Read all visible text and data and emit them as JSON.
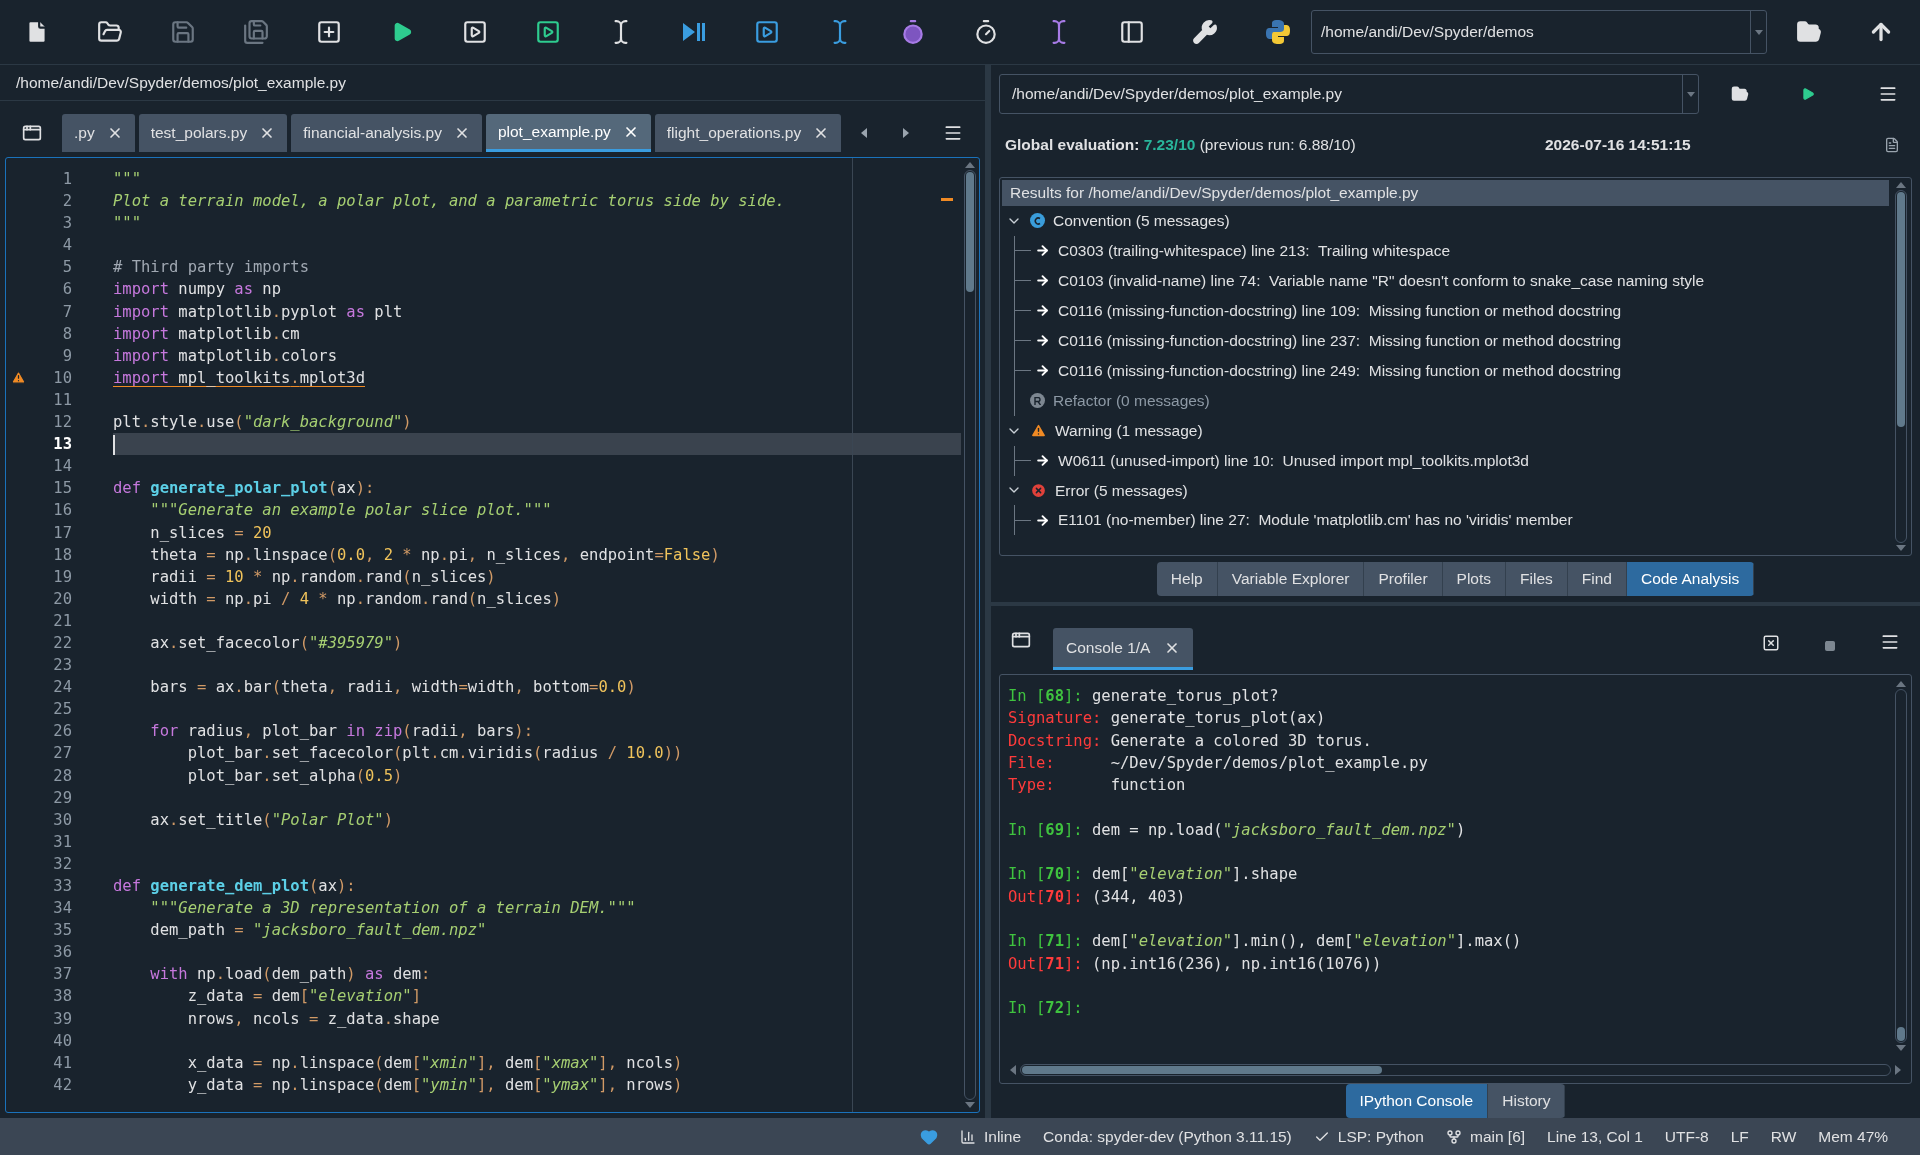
{
  "toolbar": {
    "path": "/home/andi/Dev/Spyder/demos"
  },
  "editor": {
    "file_path": "/home/andi/Dev/Spyder/demos/plot_example.py",
    "tabs": [
      {
        "label": ".py",
        "selected": false
      },
      {
        "label": "test_polars.py",
        "selected": false
      },
      {
        "label": "financial-analysis.py",
        "selected": false
      },
      {
        "label": "plot_example.py",
        "selected": true
      },
      {
        "label": "flight_operations.py",
        "selected": false
      }
    ],
    "lines": [
      {
        "number": "1",
        "current": false,
        "warning": false,
        "tokens": [
          {
            "kind": "str",
            "text": "\"\"\""
          }
        ]
      },
      {
        "number": "2",
        "current": false,
        "warning": false,
        "tokens": [
          {
            "kind": "str",
            "text": "Plot a terrain model, a polar plot, and a parametric torus side by side."
          }
        ]
      },
      {
        "number": "3",
        "current": false,
        "warning": false,
        "tokens": [
          {
            "kind": "str",
            "text": "\"\"\""
          }
        ]
      },
      {
        "number": "4",
        "current": false,
        "warning": false
      },
      {
        "number": "5",
        "current": false,
        "warning": false,
        "tokens": [
          {
            "kind": "com",
            "text": "# Third party imports"
          }
        ]
      },
      {
        "number": "6",
        "current": false,
        "warning": false,
        "tokens": [
          {
            "kind": "kw",
            "text": "import"
          },
          {
            "kind": "txt",
            "text": " numpy "
          },
          {
            "kind": "kw",
            "text": "as"
          },
          {
            "kind": "txt",
            "text": " np"
          }
        ]
      },
      {
        "number": "7",
        "current": false,
        "warning": false,
        "tokens": [
          {
            "kind": "kw",
            "text": "import"
          },
          {
            "kind": "txt",
            "text": " matplotlib"
          },
          {
            "kind": "op",
            "text": "."
          },
          {
            "kind": "txt",
            "text": "pyplot "
          },
          {
            "kind": "kw",
            "text": "as"
          },
          {
            "kind": "txt",
            "text": " plt"
          }
        ]
      },
      {
        "number": "8",
        "current": false,
        "warning": false,
        "tokens": [
          {
            "kind": "kw",
            "text": "import"
          },
          {
            "kind": "txt",
            "text": " matplotlib"
          },
          {
            "kind": "op",
            "text": "."
          },
          {
            "kind": "txt",
            "text": "cm"
          }
        ]
      },
      {
        "number": "9",
        "current": false,
        "warning": false,
        "tokens": [
          {
            "kind": "kw",
            "text": "import"
          },
          {
            "kind": "txt",
            "text": " matplotlib"
          },
          {
            "kind": "op",
            "text": "."
          },
          {
            "kind": "txt",
            "text": "colors"
          }
        ]
      },
      {
        "number": "10",
        "current": false,
        "warning": true,
        "tokens": [
          {
            "kind": "kw",
            "text": "import"
          },
          {
            "kind": "txt",
            "text": " mpl_toolkits"
          },
          {
            "kind": "op",
            "text": "."
          },
          {
            "kind": "txt",
            "text": "mplot3d"
          }
        ]
      },
      {
        "number": "11",
        "current": false,
        "warning": false
      },
      {
        "number": "12",
        "current": false,
        "warning": false,
        "tokens": [
          {
            "kind": "txt",
            "text": "plt"
          },
          {
            "kind": "op",
            "text": "."
          },
          {
            "kind": "txt",
            "text": "style"
          },
          {
            "kind": "op",
            "text": "."
          },
          {
            "kind": "txt",
            "text": "use"
          },
          {
            "kind": "op",
            "text": "("
          },
          {
            "kind": "str",
            "text": "\"dark_background\""
          },
          {
            "kind": "op",
            "text": ")"
          }
        ]
      },
      {
        "number": "13",
        "current": true,
        "warning": false
      },
      {
        "number": "14",
        "current": false,
        "warning": false
      },
      {
        "number": "15",
        "current": false,
        "warning": false,
        "tokens": [
          {
            "kind": "kw",
            "text": "def "
          },
          {
            "kind": "def",
            "text": "generate_polar_plot"
          },
          {
            "kind": "op",
            "text": "("
          },
          {
            "kind": "txt",
            "text": "ax"
          },
          {
            "kind": "op",
            "text": "):"
          }
        ]
      },
      {
        "number": "16",
        "current": false,
        "warning": false,
        "tokens": [
          {
            "kind": "str",
            "text": "    \"\"\"Generate an example polar slice plot.\"\"\""
          }
        ]
      },
      {
        "number": "17",
        "current": false,
        "warning": false,
        "tokens": [
          {
            "kind": "txt",
            "text": "    n_slices "
          },
          {
            "kind": "op",
            "text": "= "
          },
          {
            "kind": "num",
            "text": "20"
          }
        ]
      },
      {
        "number": "18",
        "current": false,
        "warning": false,
        "tokens": [
          {
            "kind": "txt",
            "text": "    theta "
          },
          {
            "kind": "op",
            "text": "="
          },
          {
            "kind": "txt",
            "text": " np"
          },
          {
            "kind": "op",
            "text": "."
          },
          {
            "kind": "txt",
            "text": "linspace"
          },
          {
            "kind": "op",
            "text": "("
          },
          {
            "kind": "num",
            "text": "0.0"
          },
          {
            "kind": "op",
            "text": ", "
          },
          {
            "kind": "num",
            "text": "2"
          },
          {
            "kind": "op",
            "text": " *"
          },
          {
            "kind": "txt",
            "text": " np"
          },
          {
            "kind": "op",
            "text": "."
          },
          {
            "kind": "txt",
            "text": "pi"
          },
          {
            "kind": "op",
            "text": ", "
          },
          {
            "kind": "txt",
            "text": "n_slices"
          },
          {
            "kind": "op",
            "text": ", "
          },
          {
            "kind": "txt",
            "text": "endpoint"
          },
          {
            "kind": "op",
            "text": "="
          },
          {
            "kind": "num",
            "text": "False"
          },
          {
            "kind": "op",
            "text": ")"
          }
        ]
      },
      {
        "number": "19",
        "current": false,
        "warning": false,
        "tokens": [
          {
            "kind": "txt",
            "text": "    radii "
          },
          {
            "kind": "op",
            "text": "= "
          },
          {
            "kind": "num",
            "text": "10"
          },
          {
            "kind": "op",
            "text": " *"
          },
          {
            "kind": "txt",
            "text": " np"
          },
          {
            "kind": "op",
            "text": "."
          },
          {
            "kind": "txt",
            "text": "random"
          },
          {
            "kind": "op",
            "text": "."
          },
          {
            "kind": "txt",
            "text": "rand"
          },
          {
            "kind": "op",
            "text": "("
          },
          {
            "kind": "txt",
            "text": "n_slices"
          },
          {
            "kind": "op",
            "text": ")"
          }
        ]
      },
      {
        "number": "20",
        "current": false,
        "warning": false,
        "tokens": [
          {
            "kind": "txt",
            "text": "    width "
          },
          {
            "kind": "op",
            "text": "="
          },
          {
            "kind": "txt",
            "text": " np"
          },
          {
            "kind": "op",
            "text": "."
          },
          {
            "kind": "txt",
            "text": "pi "
          },
          {
            "kind": "op",
            "text": "/ "
          },
          {
            "kind": "num",
            "text": "4"
          },
          {
            "kind": "op",
            "text": " *"
          },
          {
            "kind": "txt",
            "text": " np"
          },
          {
            "kind": "op",
            "text": "."
          },
          {
            "kind": "txt",
            "text": "random"
          },
          {
            "kind": "op",
            "text": "."
          },
          {
            "kind": "txt",
            "text": "rand"
          },
          {
            "kind": "op",
            "text": "("
          },
          {
            "kind": "txt",
            "text": "n_slices"
          },
          {
            "kind": "op",
            "text": ")"
          }
        ]
      },
      {
        "number": "21",
        "current": false,
        "warning": false
      },
      {
        "number": "22",
        "current": false,
        "warning": false,
        "tokens": [
          {
            "kind": "txt",
            "text": "    ax"
          },
          {
            "kind": "op",
            "text": "."
          },
          {
            "kind": "txt",
            "text": "set_facecolor"
          },
          {
            "kind": "op",
            "text": "("
          },
          {
            "kind": "str",
            "text": "\"#395979\""
          },
          {
            "kind": "op",
            "text": ")"
          }
        ]
      },
      {
        "number": "23",
        "current": false,
        "warning": false
      },
      {
        "number": "24",
        "current": false,
        "warning": false,
        "tokens": [
          {
            "kind": "txt",
            "text": "    bars "
          },
          {
            "kind": "op",
            "text": "="
          },
          {
            "kind": "txt",
            "text": " ax"
          },
          {
            "kind": "op",
            "text": "."
          },
          {
            "kind": "txt",
            "text": "bar"
          },
          {
            "kind": "op",
            "text": "("
          },
          {
            "kind": "txt",
            "text": "theta"
          },
          {
            "kind": "op",
            "text": ", "
          },
          {
            "kind": "txt",
            "text": "radii"
          },
          {
            "kind": "op",
            "text": ", "
          },
          {
            "kind": "txt",
            "text": "width"
          },
          {
            "kind": "op",
            "text": "="
          },
          {
            "kind": "txt",
            "text": "width"
          },
          {
            "kind": "op",
            "text": ", "
          },
          {
            "kind": "txt",
            "text": "bottom"
          },
          {
            "kind": "op",
            "text": "="
          },
          {
            "kind": "num",
            "text": "0.0"
          },
          {
            "kind": "op",
            "text": ")"
          }
        ]
      },
      {
        "number": "25",
        "current": false,
        "warning": false
      },
      {
        "number": "26",
        "current": false,
        "warning": false,
        "tokens": [
          {
            "kind": "kw",
            "text": "    for"
          },
          {
            "kind": "txt",
            "text": " radius"
          },
          {
            "kind": "op",
            "text": ", "
          },
          {
            "kind": "txt",
            "text": "plot_bar "
          },
          {
            "kind": "kw",
            "text": "in"
          },
          {
            "kind": "kw",
            "text": " zip"
          },
          {
            "kind": "op",
            "text": "("
          },
          {
            "kind": "txt",
            "text": "radii"
          },
          {
            "kind": "op",
            "text": ", "
          },
          {
            "kind": "txt",
            "text": "bars"
          },
          {
            "kind": "op",
            "text": "):"
          }
        ]
      },
      {
        "number": "27",
        "current": false,
        "warning": false,
        "tokens": [
          {
            "kind": "txt",
            "text": "        plot_bar"
          },
          {
            "kind": "op",
            "text": "."
          },
          {
            "kind": "txt",
            "text": "set_facecolor"
          },
          {
            "kind": "op",
            "text": "("
          },
          {
            "kind": "txt",
            "text": "plt"
          },
          {
            "kind": "op",
            "text": "."
          },
          {
            "kind": "txt",
            "text": "cm"
          },
          {
            "kind": "op",
            "text": "."
          },
          {
            "kind": "txt",
            "text": "viridis"
          },
          {
            "kind": "op",
            "text": "("
          },
          {
            "kind": "txt",
            "text": "radius "
          },
          {
            "kind": "op",
            "text": "/ "
          },
          {
            "kind": "num",
            "text": "10.0"
          },
          {
            "kind": "op",
            "text": "))"
          }
        ]
      },
      {
        "number": "28",
        "current": false,
        "warning": false,
        "tokens": [
          {
            "kind": "txt",
            "text": "        plot_bar"
          },
          {
            "kind": "op",
            "text": "."
          },
          {
            "kind": "txt",
            "text": "set_alpha"
          },
          {
            "kind": "op",
            "text": "("
          },
          {
            "kind": "num",
            "text": "0.5"
          },
          {
            "kind": "op",
            "text": ")"
          }
        ]
      },
      {
        "number": "29",
        "current": false,
        "warning": false
      },
      {
        "number": "30",
        "current": false,
        "warning": false,
        "tokens": [
          {
            "kind": "txt",
            "text": "    ax"
          },
          {
            "kind": "op",
            "text": "."
          },
          {
            "kind": "txt",
            "text": "set_title"
          },
          {
            "kind": "op",
            "text": "("
          },
          {
            "kind": "str",
            "text": "\"Polar Plot\""
          },
          {
            "kind": "op",
            "text": ")"
          }
        ]
      },
      {
        "number": "31",
        "current": false,
        "warning": false
      },
      {
        "number": "32",
        "current": false,
        "warning": false
      },
      {
        "number": "33",
        "current": false,
        "warning": false,
        "tokens": [
          {
            "kind": "kw",
            "text": "def "
          },
          {
            "kind": "def",
            "text": "generate_dem_plot"
          },
          {
            "kind": "op",
            "text": "("
          },
          {
            "kind": "txt",
            "text": "ax"
          },
          {
            "kind": "op",
            "text": "):"
          }
        ]
      },
      {
        "number": "34",
        "current": false,
        "warning": false,
        "tokens": [
          {
            "kind": "str",
            "text": "    \"\"\"Generate a 3D representation of a terrain DEM.\"\"\""
          }
        ]
      },
      {
        "number": "35",
        "current": false,
        "warning": false,
        "tokens": [
          {
            "kind": "txt",
            "text": "    dem_path "
          },
          {
            "kind": "op",
            "text": "= "
          },
          {
            "kind": "str",
            "text": "\"jacksboro_fault_dem.npz\""
          }
        ]
      },
      {
        "number": "36",
        "current": false,
        "warning": false
      },
      {
        "number": "37",
        "current": false,
        "warning": false,
        "tokens": [
          {
            "kind": "kw",
            "text": "    with"
          },
          {
            "kind": "txt",
            "text": " np"
          },
          {
            "kind": "op",
            "text": "."
          },
          {
            "kind": "txt",
            "text": "load"
          },
          {
            "kind": "op",
            "text": "("
          },
          {
            "kind": "txt",
            "text": "dem_path"
          },
          {
            "kind": "op",
            "text": ")"
          },
          {
            "kind": "kw",
            "text": " as"
          },
          {
            "kind": "txt",
            "text": " dem"
          },
          {
            "kind": "op",
            "text": ":"
          }
        ]
      },
      {
        "number": "38",
        "current": false,
        "warning": false,
        "tokens": [
          {
            "kind": "txt",
            "text": "        z_data "
          },
          {
            "kind": "op",
            "text": "="
          },
          {
            "kind": "txt",
            "text": " dem"
          },
          {
            "kind": "op",
            "text": "["
          },
          {
            "kind": "str",
            "text": "\"elevation\""
          },
          {
            "kind": "op",
            "text": "]"
          }
        ]
      },
      {
        "number": "39",
        "current": false,
        "warning": false,
        "tokens": [
          {
            "kind": "txt",
            "text": "        nrows"
          },
          {
            "kind": "op",
            "text": ", "
          },
          {
            "kind": "txt",
            "text": "ncols "
          },
          {
            "kind": "op",
            "text": "="
          },
          {
            "kind": "txt",
            "text": " z_data"
          },
          {
            "kind": "op",
            "text": "."
          },
          {
            "kind": "txt",
            "text": "shape"
          }
        ]
      },
      {
        "number": "40",
        "current": false,
        "warning": false
      },
      {
        "number": "41",
        "current": false,
        "warning": false,
        "tokens": [
          {
            "kind": "txt",
            "text": "        x_data "
          },
          {
            "kind": "op",
            "text": "="
          },
          {
            "kind": "txt",
            "text": " np"
          },
          {
            "kind": "op",
            "text": "."
          },
          {
            "kind": "txt",
            "text": "linspace"
          },
          {
            "kind": "op",
            "text": "("
          },
          {
            "kind": "txt",
            "text": "dem"
          },
          {
            "kind": "op",
            "text": "["
          },
          {
            "kind": "str",
            "text": "\"xmin\""
          },
          {
            "kind": "op",
            "text": "], "
          },
          {
            "kind": "txt",
            "text": "dem"
          },
          {
            "kind": "op",
            "text": "["
          },
          {
            "kind": "str",
            "text": "\"xmax\""
          },
          {
            "kind": "op",
            "text": "], "
          },
          {
            "kind": "txt",
            "text": "ncols"
          },
          {
            "kind": "op",
            "text": ")"
          }
        ]
      },
      {
        "number": "42",
        "current": false,
        "warning": false,
        "tokens": [
          {
            "kind": "txt",
            "text": "        y_data "
          },
          {
            "kind": "op",
            "text": "="
          },
          {
            "kind": "txt",
            "text": " np"
          },
          {
            "kind": "op",
            "text": "."
          },
          {
            "kind": "txt",
            "text": "linspace"
          },
          {
            "kind": "op",
            "text": "("
          },
          {
            "kind": "txt",
            "text": "dem"
          },
          {
            "kind": "op",
            "text": "["
          },
          {
            "kind": "str",
            "text": "\"ymin\""
          },
          {
            "kind": "op",
            "text": "], "
          },
          {
            "kind": "txt",
            "text": "dem"
          },
          {
            "kind": "op",
            "text": "["
          },
          {
            "kind": "str",
            "text": "\"ymax\""
          },
          {
            "kind": "op",
            "text": "], "
          },
          {
            "kind": "txt",
            "text": "nrows"
          },
          {
            "kind": "op",
            "text": ")"
          }
        ]
      }
    ]
  },
  "code_analysis": {
    "file_path": "/home/andi/Dev/Spyder/demos/plot_example.py",
    "global_label": "Global evaluation:",
    "score": "7.23/10",
    "previous": "(previous run: 6.88/10)",
    "date": "2026-07-16 14:51:15",
    "results_header": "Results for /home/andi/Dev/Spyder/demos/plot_example.py",
    "groups": [
      {
        "kind": "convention",
        "label": "Convention (5 messages)",
        "expanded": true,
        "children": [
          {
            "text": "C0303 (trailing-whitespace) line 213:  Trailing whitespace"
          },
          {
            "text": "C0103 (invalid-name) line 74:  Variable name \"R\" doesn't conform to snake_case naming style"
          },
          {
            "text": "C0116 (missing-function-docstring) line 109:  Missing function or method docstring"
          },
          {
            "text": "C0116 (missing-function-docstring) line 237:  Missing function or method docstring"
          },
          {
            "text": "C0116 (missing-function-docstring) line 249:  Missing function or method docstring"
          }
        ]
      },
      {
        "kind": "refactor",
        "label": "Refactor (0 messages)",
        "expanded": false
      },
      {
        "kind": "warning",
        "label": "Warning (1 message)",
        "expanded": true,
        "children": [
          {
            "text": "W0611 (unused-import) line 10:  Unused import mpl_toolkits.mplot3d"
          }
        ]
      },
      {
        "kind": "error",
        "label": "Error (5 messages)",
        "expanded": true,
        "children": [
          {
            "text": "E1101 (no-member) line 27:  Module 'matplotlib.cm' has no 'viridis' member"
          }
        ]
      }
    ],
    "panes": [
      {
        "label": "Help",
        "selected": false
      },
      {
        "label": "Variable Explorer",
        "selected": false
      },
      {
        "label": "Profiler",
        "selected": false
      },
      {
        "label": "Plots",
        "selected": false
      },
      {
        "label": "Files",
        "selected": false
      },
      {
        "label": "Find",
        "selected": false
      },
      {
        "label": "Code Analysis",
        "selected": true
      }
    ]
  },
  "console": {
    "tabs": [
      {
        "label": "Console 1/A",
        "selected": true
      }
    ],
    "lines": [
      {
        "spaced": false,
        "tokens": [
          {
            "kind": "in",
            "text": "In [**68**]:"
          },
          {
            "kind": "txt",
            "text": " generate_torus_plot?"
          }
        ]
      },
      {
        "spaced": false,
        "tokens": [
          {
            "kind": "label",
            "text": "Signature:"
          },
          {
            "kind": "txt",
            "text": " generate_torus_plot(ax)"
          }
        ]
      },
      {
        "spaced": false,
        "tokens": [
          {
            "kind": "label",
            "text": "Docstring:"
          },
          {
            "kind": "txt",
            "text": " Generate a colored 3D torus."
          }
        ]
      },
      {
        "spaced": false,
        "tokens": [
          {
            "kind": "label",
            "text": "File:"
          },
          {
            "kind": "txt",
            "text": "      ~/Dev/Spyder/demos/plot_example.py"
          }
        ]
      },
      {
        "spaced": false,
        "tokens": [
          {
            "kind": "label",
            "text": "Type:"
          },
          {
            "kind": "txt",
            "text": "      function"
          }
        ]
      },
      {
        "spaced": true,
        "tokens": [
          {
            "kind": "in",
            "text": "In [**69**]:"
          },
          {
            "kind": "txt",
            "text": " dem = np.load("
          },
          {
            "kind": "str",
            "text": "\"jacksboro_fault_dem.npz\""
          },
          {
            "kind": "txt",
            "text": ")"
          }
        ]
      },
      {
        "spaced": true,
        "tokens": [
          {
            "kind": "in",
            "text": "In [**70**]:"
          },
          {
            "kind": "txt",
            "text": " dem["
          },
          {
            "kind": "str",
            "text": "\"elevation\""
          },
          {
            "kind": "txt",
            "text": "].shape"
          }
        ]
      },
      {
        "spaced": false,
        "tokens": [
          {
            "kind": "out",
            "text": "Out[**70**]:"
          },
          {
            "kind": "txt",
            "text": " (344, 403)"
          }
        ]
      },
      {
        "spaced": true,
        "tokens": [
          {
            "kind": "in",
            "text": "In [**71**]:"
          },
          {
            "kind": "txt",
            "text": " dem["
          },
          {
            "kind": "str",
            "text": "\"elevation\""
          },
          {
            "kind": "txt",
            "text": "].min(), dem["
          },
          {
            "kind": "str",
            "text": "\"elevation\""
          },
          {
            "kind": "txt",
            "text": "].max()"
          }
        ]
      },
      {
        "spaced": false,
        "tokens": [
          {
            "kind": "out",
            "text": "Out[**71**]:"
          },
          {
            "kind": "txt",
            "text": " (np.int16(236), np.int16(1076))"
          }
        ]
      },
      {
        "spaced": true,
        "tokens": [
          {
            "kind": "in",
            "text": "In [**72**]:"
          }
        ]
      }
    ],
    "panes": [
      {
        "label": "IPython Console",
        "selected": true
      },
      {
        "label": "History",
        "selected": false
      }
    ]
  },
  "status_bar": [
    {
      "kind": "inline",
      "text": "Inline"
    },
    {
      "kind": "plain",
      "text": "Conda: spyder-dev (Python 3.11.15)"
    },
    {
      "kind": "lsp",
      "text": "LSP: Python"
    },
    {
      "kind": "branch",
      "text": "main [6]"
    },
    {
      "kind": "plain",
      "text": "Line 13, Col 1"
    },
    {
      "kind": "plain",
      "text": "UTF-8"
    },
    {
      "kind": "plain",
      "text": "LF"
    },
    {
      "kind": "plain",
      "text": "RW"
    },
    {
      "kind": "plain",
      "text": "Mem 47%"
    }
  ]
}
